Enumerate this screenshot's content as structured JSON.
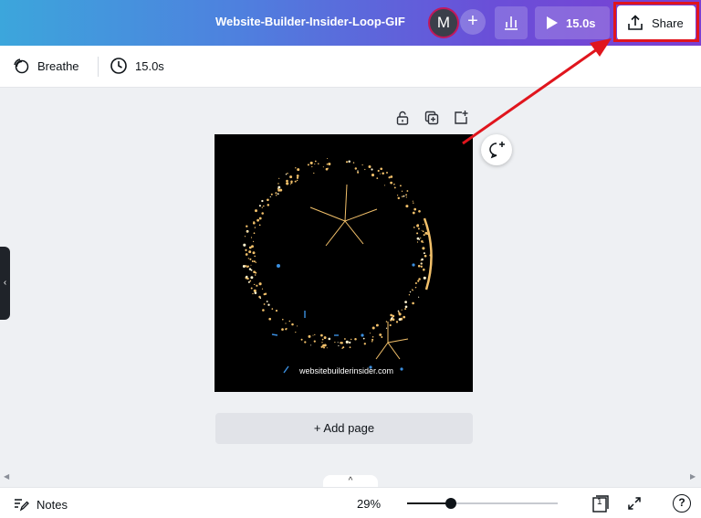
{
  "header": {
    "doc_title": "Website-Builder-Insider-Loop-GIF",
    "avatar_initial": "M",
    "add_collaborator_label": "+",
    "play_duration": "15.0s",
    "share_label": "Share"
  },
  "toolbar": {
    "animation_label": "Breathe",
    "duration_label": "15.0s"
  },
  "canvas": {
    "watermark_text": "websitebuilderinsider.com"
  },
  "editor": {
    "add_page_label": "+ Add page",
    "expand_label": "^",
    "side_tab_label": "‹"
  },
  "footer": {
    "notes_label": "Notes",
    "zoom_label": "29%",
    "zoom_level": 0.29,
    "page_count": "1",
    "help_label": "?"
  },
  "colors": {
    "gradient_start": "#3ca6dc",
    "gradient_end": "#7b3fd2",
    "highlight_red": "#e0151d",
    "sparkle_gold": "#f2c06a",
    "sparkle_blue": "#3b8fe0"
  },
  "icons": [
    "breathe-icon",
    "clock-icon",
    "insights-icon",
    "play-icon",
    "share-icon",
    "lock-icon",
    "duplicate-icon",
    "add-page-icon",
    "comment-add-icon",
    "notes-icon",
    "pages-icon",
    "fullscreen-icon",
    "help-icon"
  ]
}
